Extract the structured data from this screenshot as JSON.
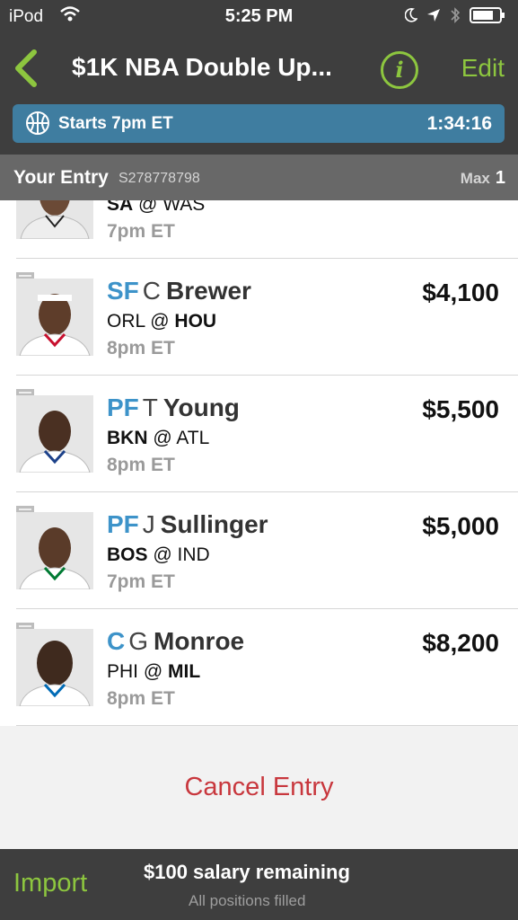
{
  "status_bar": {
    "carrier": "iPod",
    "time": "5:25 PM"
  },
  "nav": {
    "title": "$1K NBA Double Up...",
    "info_label": "i",
    "edit_label": "Edit"
  },
  "banner": {
    "starts": "Starts 7pm ET",
    "countdown": "1:34:16"
  },
  "entry_header": {
    "label": "Your Entry",
    "entry_id": "S278778798",
    "max_label": "Max",
    "max_value": "1"
  },
  "players": [
    {
      "pos": "",
      "first_initial": "",
      "last_name": "",
      "away": "SA",
      "at": "@",
      "home": "WAS",
      "bold_team": "away",
      "time": "7pm ET",
      "salary": "",
      "jersey_color": "#e8e8e8"
    },
    {
      "pos": "SF",
      "first_initial": "C",
      "last_name": "Brewer",
      "away": "ORL",
      "at": "@",
      "home": "HOU",
      "bold_team": "home",
      "time": "8pm ET",
      "salary": "$4,100",
      "jersey_color": "#ffffff"
    },
    {
      "pos": "PF",
      "first_initial": "T",
      "last_name": "Young",
      "away": "BKN",
      "at": "@",
      "home": "ATL",
      "bold_team": "away",
      "time": "8pm ET",
      "salary": "$5,500",
      "jersey_color": "#ffffff"
    },
    {
      "pos": "PF",
      "first_initial": "J",
      "last_name": "Sullinger",
      "away": "BOS",
      "at": "@",
      "home": "IND",
      "bold_team": "away",
      "time": "7pm ET",
      "salary": "$5,000",
      "jersey_color": "#ffffff"
    },
    {
      "pos": "C",
      "first_initial": "G",
      "last_name": "Monroe",
      "away": "PHI",
      "at": "@",
      "home": "MIL",
      "bold_team": "home",
      "time": "8pm ET",
      "salary": "$8,200",
      "jersey_color": "#ffffff"
    }
  ],
  "cancel": {
    "label": "Cancel Entry"
  },
  "footer": {
    "import_label": "Import",
    "salary_remaining": "$100 salary remaining",
    "positions_status": "All positions filled"
  },
  "colors": {
    "accent_green": "#8dc63f",
    "position_blue": "#3d93c9",
    "banner_blue": "#3f7da0",
    "cancel_red": "#c8373d",
    "dark_bar": "#3e3e3e"
  }
}
